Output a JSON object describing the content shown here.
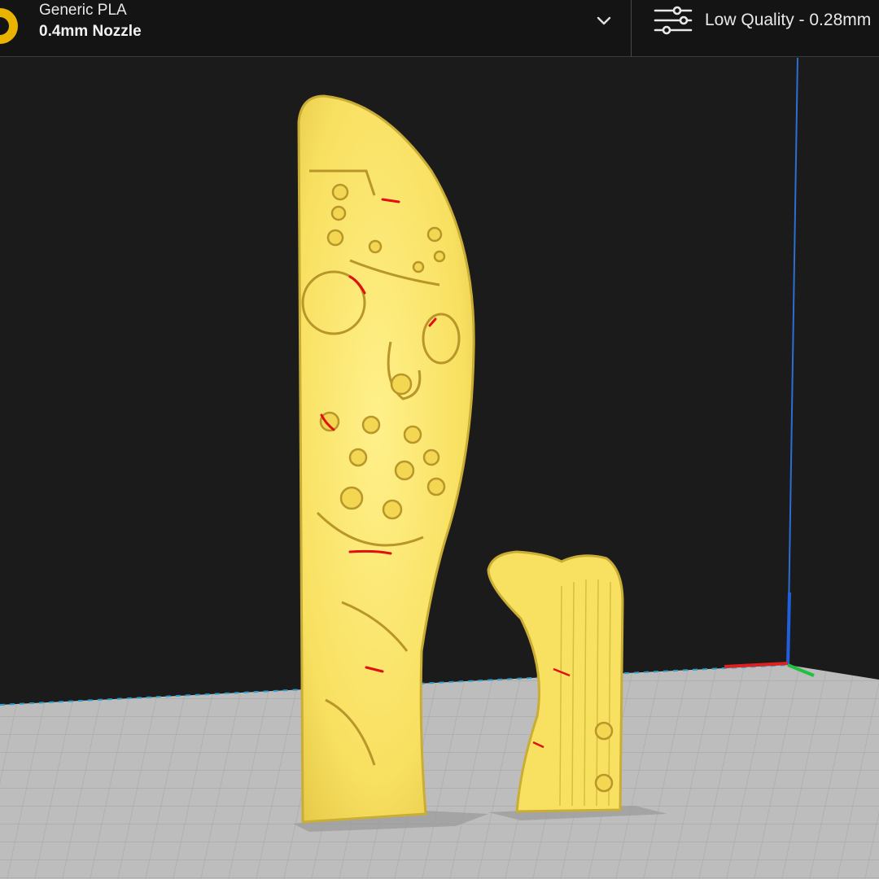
{
  "toolbar": {
    "material": "Generic PLA",
    "nozzle": "0.4mm Nozzle",
    "print_profile": "Low Quality - 0.28mm"
  },
  "icons": {
    "material_logo": "ring-logo-icon",
    "dropdown": "chevron-down-icon",
    "settings": "sliders-icon"
  },
  "colors": {
    "topbar": "#141414",
    "viewport_background": "#1b1b1b",
    "build_plate": "#b9b9b9",
    "model": "#f8e060",
    "overhang": "#e01010",
    "axis_x": "#e02020",
    "axis_y": "#20c040",
    "axis_z": "#2060e0",
    "accent": "#e9b400"
  },
  "scene": {
    "objects": [
      "knife-blade-model",
      "knife-handle-model"
    ]
  }
}
